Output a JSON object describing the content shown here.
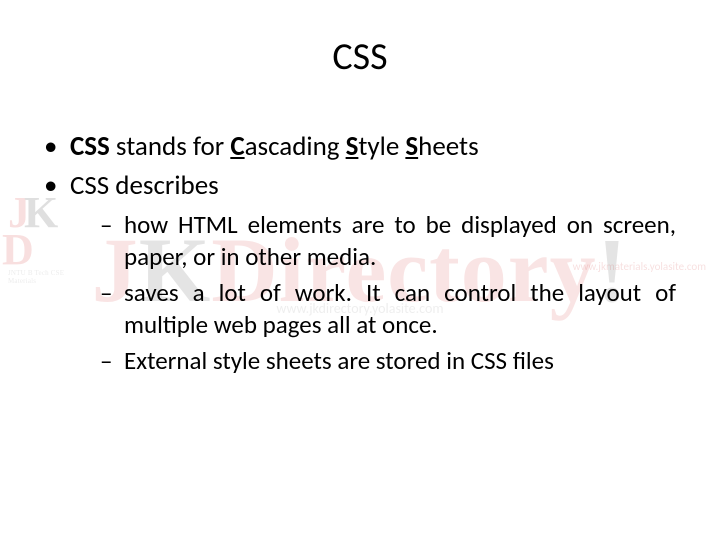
{
  "title": "CSS",
  "bullets": [
    {
      "segments": [
        {
          "text": "CSS",
          "bold": true,
          "underline": false
        },
        {
          "text": " stands for ",
          "bold": false,
          "underline": false
        },
        {
          "text": "C",
          "bold": true,
          "underline": true
        },
        {
          "text": "ascading ",
          "bold": false,
          "underline": false
        },
        {
          "text": "S",
          "bold": true,
          "underline": true
        },
        {
          "text": "tyle ",
          "bold": false,
          "underline": false
        },
        {
          "text": "S",
          "bold": true,
          "underline": true
        },
        {
          "text": "heets",
          "bold": false,
          "underline": false
        }
      ]
    },
    {
      "segments": [
        {
          "text": "CSS describes",
          "bold": false,
          "underline": false
        }
      ],
      "sub": [
        "how HTML elements are to be displayed on screen, paper, or in other media.",
        "saves a lot of work. It can control the layout of multiple web pages all at once.",
        "External style sheets are stored in CSS files"
      ]
    }
  ],
  "watermark": {
    "brand_j": "J",
    "brand_k": "K",
    "brand_rest": "Directory",
    "brand_bang": "!",
    "subline": "www.jkdirectory.yolasite.com",
    "right": "www.jkmaterials.yolasite.com",
    "left_tag": "JNTU B Tech CSE Materials"
  }
}
